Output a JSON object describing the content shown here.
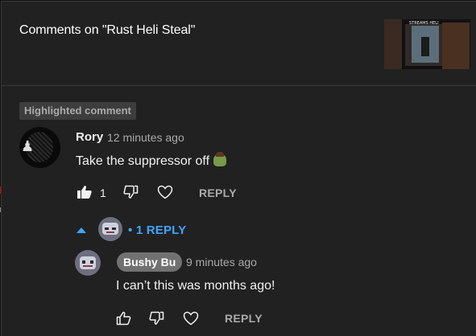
{
  "header": {
    "title": "Comments on \"Rust Heli Steal\"",
    "thumbnail_caption": "STREAMS HELI"
  },
  "highlight_badge": "Highlighted comment",
  "comment": {
    "author": "Rory",
    "time": "12 minutes ago",
    "text": "Take the suppressor off",
    "likes": "1",
    "reply_label": "REPLY"
  },
  "replies_toggle": {
    "label": "1 REPLY",
    "separator": "•"
  },
  "reply": {
    "author": "Bushy Bu",
    "time": "9 minutes ago",
    "text": "I can’t this was months ago!",
    "reply_label": "REPLY"
  },
  "colors": {
    "background": "#212121",
    "accent": "#3ea6ff",
    "muted": "#aaaaaa"
  }
}
